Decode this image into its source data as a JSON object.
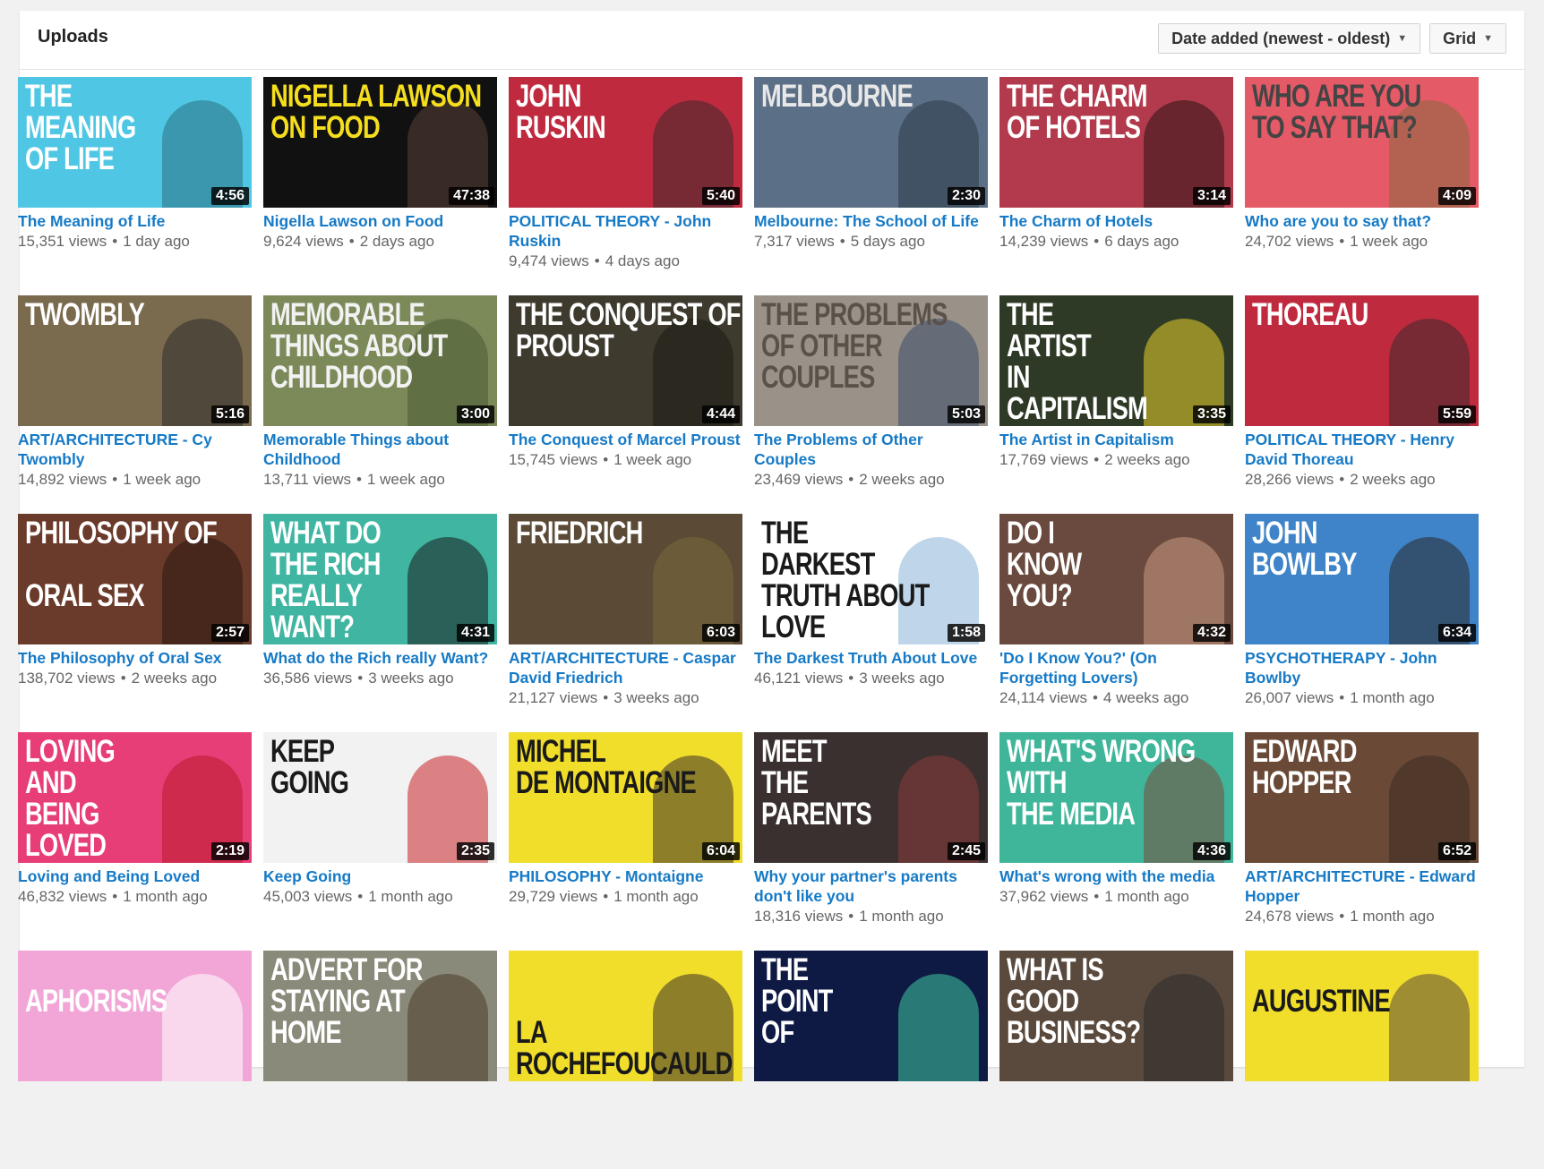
{
  "header": {
    "title": "Uploads",
    "sort_label": "Date added (newest - oldest)",
    "view_label": "Grid"
  },
  "videos": [
    {
      "thumb_text": "THE\nMEANING\nOF LIFE",
      "duration": "4:56",
      "title": "The Meaning of Life",
      "views": "15,351 views",
      "age": "1 day ago",
      "bg": "#4fc7e4",
      "fg": "#ffffff",
      "fig": "#2c6f80"
    },
    {
      "thumb_text": "NIGELLA LAWSON\nON FOOD",
      "duration": "47:38",
      "title": "Nigella Lawson on Food",
      "views": "9,624 views",
      "age": "2 days ago",
      "bg": "#111111",
      "fg": "#f5de1e",
      "fig": "#5a4036"
    },
    {
      "thumb_text": "JOHN\nRUSKIN",
      "duration": "5:40",
      "title": "POLITICAL THEORY - John Ruskin",
      "views": "9,474 views",
      "age": "4 days ago",
      "bg": "#c02a3f",
      "fg": "#ffffff",
      "fig": "#3b2a2a"
    },
    {
      "thumb_text": "MELBOURNE",
      "duration": "2:30",
      "title": "Melbourne: The School of Life",
      "views": "7,317 views",
      "age": "5 days ago",
      "bg": "#5b6f86",
      "fg": "#e8e8e8",
      "fig": "#2d3a4a"
    },
    {
      "thumb_text": "THE CHARM\nOF HOTELS",
      "duration": "3:14",
      "title": "The Charm of Hotels",
      "views": "14,239 views",
      "age": "6 days ago",
      "bg": "#b33a4c",
      "fg": "#ffffff",
      "fig": "#2a1416"
    },
    {
      "thumb_text": "WHO ARE YOU\nTO SAY THAT?",
      "duration": "4:09",
      "title": "Who are you to say that?",
      "views": "24,702 views",
      "age": "1 week ago",
      "bg": "#e45a66",
      "fg": "#444444",
      "fig": "#8a6a42"
    },
    {
      "thumb_text": "TWOMBLY",
      "duration": "5:16",
      "title": "ART/ARCHITECTURE - Cy Twombly",
      "views": "14,892 views",
      "age": "1 week ago",
      "bg": "#7a6a4e",
      "fg": "#ffffff",
      "fig": "#2b2b2b"
    },
    {
      "thumb_text": "MEMORABLE\nTHINGS ABOUT\nCHILDHOOD",
      "duration": "3:00",
      "title": "Memorable Things about Childhood",
      "views": "13,711 views",
      "age": "1 week ago",
      "bg": "#7c8a5a",
      "fg": "#f2f2f2",
      "fig": "#4a5a35"
    },
    {
      "thumb_text": "THE CONQUEST OF\nPROUST",
      "duration": "4:44",
      "title": "The Conquest of Marcel Proust",
      "views": "15,745 views",
      "age": "1 week ago",
      "bg": "#3e3a2e",
      "fg": "#ffffff",
      "fig": "#1c1a14"
    },
    {
      "thumb_text": "THE PROBLEMS\nOF OTHER\nCOUPLES",
      "duration": "5:03",
      "title": "The Problems of Other Couples",
      "views": "23,469 views",
      "age": "2 weeks ago",
      "bg": "#9a9288",
      "fg": "#5a524a",
      "fig": "#3a4a6a"
    },
    {
      "thumb_text": "THE\nARTIST\nIN\nCAPITALISM",
      "duration": "3:35",
      "title": "The Artist in Capitalism",
      "views": "17,769 views",
      "age": "2 weeks ago",
      "bg": "#2e3a26",
      "fg": "#ffffff",
      "fig": "#e8cf2a"
    },
    {
      "thumb_text": "THOREAU",
      "duration": "5:59",
      "title": "POLITICAL THEORY - Henry David Thoreau",
      "views": "28,266 views",
      "age": "2 weeks ago",
      "bg": "#c02a3f",
      "fg": "#ffffff",
      "fig": "#3b2a2a"
    },
    {
      "thumb_text": "PHILOSOPHY OF\n\nORAL SEX",
      "duration": "2:57",
      "title": "The Philosophy of Oral Sex",
      "views": "138,702 views",
      "age": "2 weeks ago",
      "bg": "#6a3a2a",
      "fg": "#ffffff",
      "fig": "#2a1810"
    },
    {
      "thumb_text": "WHAT DO\nTHE RICH\nREALLY\nWANT?",
      "duration": "4:31",
      "title": "What do the Rich really Want?",
      "views": "36,586 views",
      "age": "3 weeks ago",
      "bg": "#3fb5a2",
      "fg": "#ffffff",
      "fig": "#1a1a1a"
    },
    {
      "thumb_text": "FRIEDRICH",
      "duration": "6:03",
      "title": "ART/ARCHITECTURE - Caspar David Friedrich",
      "views": "21,127 views",
      "age": "3 weeks ago",
      "bg": "#5a4a36",
      "fg": "#ffffff",
      "fig": "#7a6a3a"
    },
    {
      "thumb_text": "THE\nDARKEST\nTRUTH ABOUT LOVE",
      "duration": "1:58",
      "title": "The Darkest Truth About Love",
      "views": "46,121 views",
      "age": "3 weeks ago",
      "bg": "#ffffff",
      "fg": "#1a1a1a",
      "fig": "#8ab4d8"
    },
    {
      "thumb_text": "DO I\nKNOW\nYOU?",
      "duration": "4:32",
      "title": "'Do I Know You?' (On Forgetting Lovers)",
      "views": "24,114 views",
      "age": "4 weeks ago",
      "bg": "#6a4a3e",
      "fg": "#ffffff",
      "fig": "#c89a82"
    },
    {
      "thumb_text": "JOHN\nBOWLBY",
      "duration": "6:34",
      "title": "PSYCHOTHERAPY - John Bowlby",
      "views": "26,007 views",
      "age": "1 month ago",
      "bg": "#3f84c8",
      "fg": "#ffffff",
      "fig": "#2a2a2a"
    },
    {
      "thumb_text": "LOVING\nAND\nBEING\nLOVED",
      "duration": "2:19",
      "title": "Loving and Being Loved",
      "views": "46,832 views",
      "age": "1 month ago",
      "bg": "#e83e78",
      "fg": "#ffffff",
      "fig": "#b81a2a"
    },
    {
      "thumb_text": "KEEP\nGOING",
      "duration": "2:35",
      "title": "Keep Going",
      "views": "45,003 views",
      "age": "1 month ago",
      "bg": "#f2f2f2",
      "fg": "#1a1a1a",
      "fig": "#c8242a"
    },
    {
      "thumb_text": "MICHEL\nDE MONTAIGNE",
      "duration": "6:04",
      "title": "PHILOSOPHY - Montaigne",
      "views": "29,729 views",
      "age": "1 month ago",
      "bg": "#f1de2a",
      "fg": "#1a1a1a",
      "fig": "#3a3028"
    },
    {
      "thumb_text": "MEET\nTHE\nPARENTS",
      "duration": "2:45",
      "title": "Why your partner's parents don't like you",
      "views": "18,316 views",
      "age": "1 month ago",
      "bg": "#3a3030",
      "fg": "#ffffff",
      "fig": "#8a3a3a"
    },
    {
      "thumb_text": "WHAT'S WRONG WITH\nTHE MEDIA",
      "duration": "4:36",
      "title": "What's wrong with the media",
      "views": "37,962 views",
      "age": "1 month ago",
      "bg": "#3fb59a",
      "fg": "#ffffff",
      "fig": "#7a4a3a"
    },
    {
      "thumb_text": "EDWARD\nHOPPER",
      "duration": "6:52",
      "title": "ART/ARCHITECTURE - Edward Hopper",
      "views": "24,678 views",
      "age": "1 month ago",
      "bg": "#6a4a36",
      "fg": "#ffffff",
      "fig": "#3a2a22"
    },
    {
      "thumb_text": "\n APHORISMS",
      "duration": "",
      "title": "",
      "views": "",
      "age": "",
      "bg": "#f2a6d8",
      "fg": "#ffffff",
      "fig": "#ffffff"
    },
    {
      "thumb_text": "ADVERT FOR\nSTAYING AT\nHOME",
      "duration": "",
      "title": "",
      "views": "",
      "age": "",
      "bg": "#8a8a7a",
      "fg": "#ffffff",
      "fig": "#4a3a2a"
    },
    {
      "thumb_text": "\n\nLA ROCHEFOUCAULD",
      "duration": "",
      "title": "",
      "views": "",
      "age": "",
      "bg": "#f1de2a",
      "fg": "#1a1a1a",
      "fig": "#3a3028"
    },
    {
      "thumb_text": "THE\nPOINT\nOF",
      "duration": "",
      "title": "",
      "views": "",
      "age": "",
      "bg": "#0e1a44",
      "fg": "#ffffff",
      "fig": "#3fc8a2"
    },
    {
      "thumb_text": "WHAT IS\nGOOD\nBUSINESS?",
      "duration": "",
      "title": "",
      "views": "",
      "age": "",
      "bg": "#5a4a3e",
      "fg": "#ffffff",
      "fig": "#2a2a2a"
    },
    {
      "thumb_text": "\nAUGUSTINE",
      "duration": "",
      "title": "",
      "views": "",
      "age": "",
      "bg": "#f1de2a",
      "fg": "#1a1a1a",
      "fig": "#5a4a3a"
    }
  ]
}
